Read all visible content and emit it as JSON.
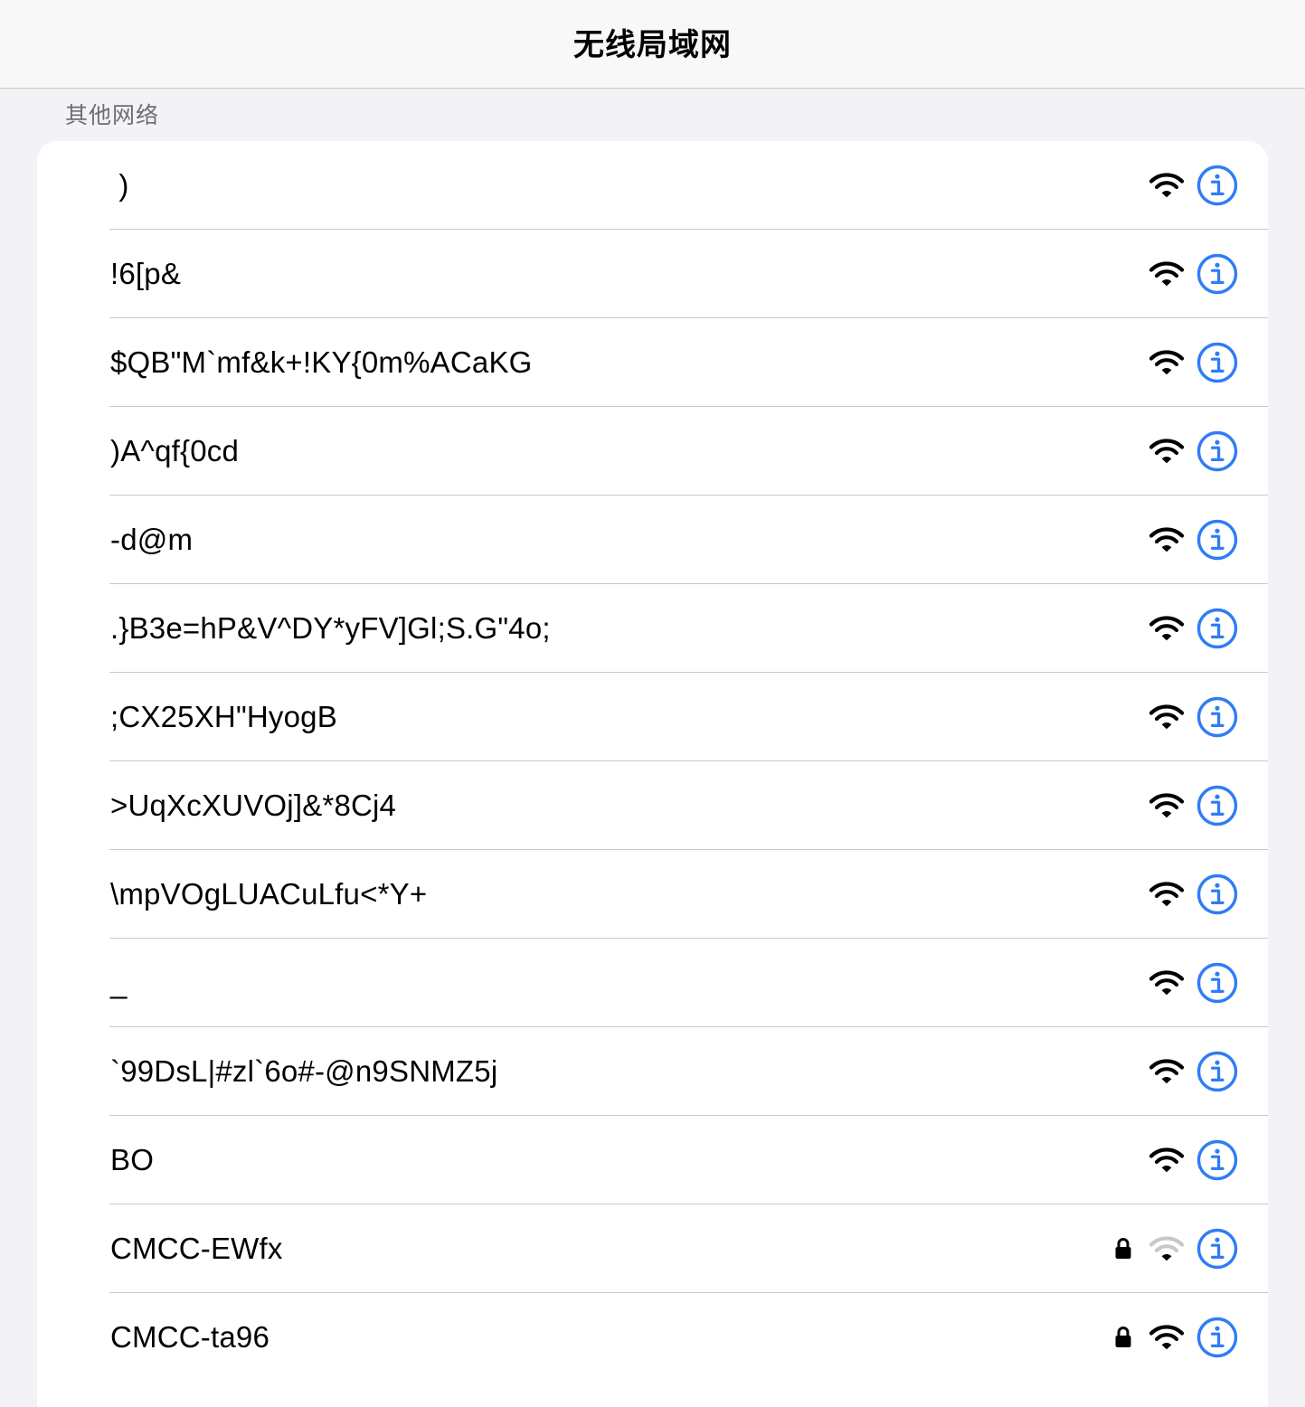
{
  "header": {
    "title": "无线局域网"
  },
  "section": {
    "title": "其他网络"
  },
  "colors": {
    "accent": "#2f7cf6",
    "background": "#f2f2f7",
    "card": "#ffffff",
    "divider": "#c8c7cc",
    "section_text": "#6d6d72"
  },
  "networks": [
    {
      "name": " )",
      "locked": false,
      "signal": "full",
      "info_icon": "info-icon",
      "wifi_icon": "wifi-icon"
    },
    {
      "name": "!6[p&",
      "locked": false,
      "signal": "full",
      "info_icon": "info-icon",
      "wifi_icon": "wifi-icon"
    },
    {
      "name": "$QB\"M`mf&k+!KY{0m%ACaKG",
      "locked": false,
      "signal": "full",
      "info_icon": "info-icon",
      "wifi_icon": "wifi-icon"
    },
    {
      "name": ")A^qf{0cd",
      "locked": false,
      "signal": "full",
      "info_icon": "info-icon",
      "wifi_icon": "wifi-icon"
    },
    {
      "name": "-d@m",
      "locked": false,
      "signal": "full",
      "info_icon": "info-icon",
      "wifi_icon": "wifi-icon"
    },
    {
      "name": ".}B3e=hP&V^DY*yFV]Gl;S.G\"4o;",
      "locked": false,
      "signal": "full",
      "info_icon": "info-icon",
      "wifi_icon": "wifi-icon"
    },
    {
      "name": ";CX25XH\"HyogB",
      "locked": false,
      "signal": "full",
      "info_icon": "info-icon",
      "wifi_icon": "wifi-icon"
    },
    {
      "name": ">UqXcXUVOj]&*8Cj4",
      "locked": false,
      "signal": "full",
      "info_icon": "info-icon",
      "wifi_icon": "wifi-icon"
    },
    {
      "name": "\\mpVOgLUACuLfu<*Y+",
      "locked": false,
      "signal": "full",
      "info_icon": "info-icon",
      "wifi_icon": "wifi-icon"
    },
    {
      "name": "_",
      "locked": false,
      "signal": "full",
      "info_icon": "info-icon",
      "wifi_icon": "wifi-icon"
    },
    {
      "name": "`99DsL|#zl`6o#-@n9SNMZ5j",
      "locked": false,
      "signal": "full",
      "info_icon": "info-icon",
      "wifi_icon": "wifi-icon"
    },
    {
      "name": "BO",
      "locked": false,
      "signal": "full",
      "info_icon": "info-icon",
      "wifi_icon": "wifi-icon"
    },
    {
      "name": "CMCC-EWfx",
      "locked": true,
      "signal": "low",
      "info_icon": "info-icon",
      "wifi_icon": "wifi-icon",
      "lock_icon": "lock-icon"
    },
    {
      "name": "CMCC-ta96",
      "locked": true,
      "signal": "full",
      "info_icon": "info-icon",
      "wifi_icon": "wifi-icon",
      "lock_icon": "lock-icon"
    }
  ]
}
